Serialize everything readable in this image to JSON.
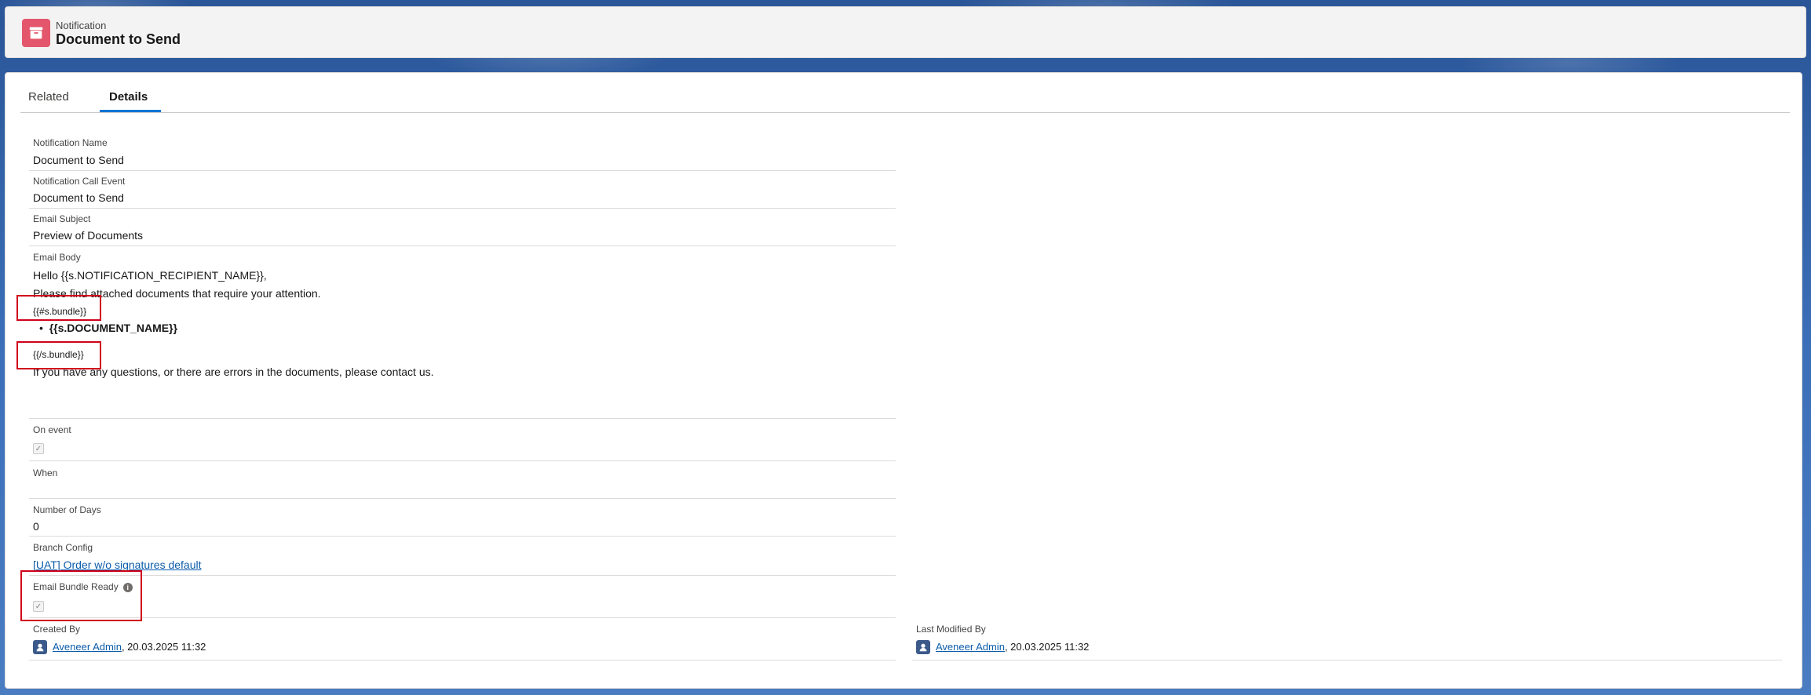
{
  "header": {
    "object_label": "Notification",
    "record_title": "Document to Send",
    "icon": "notification-icon"
  },
  "tabs": [
    {
      "label": "Related",
      "active": false
    },
    {
      "label": "Details",
      "active": true
    }
  ],
  "fields": {
    "notification_name": {
      "label": "Notification Name",
      "value": "Document to Send"
    },
    "call_event": {
      "label": "Notification Call Event",
      "value": "Document to Send"
    },
    "email_subject": {
      "label": "Email Subject",
      "value": "Preview of Documents"
    },
    "email_body": {
      "label": "Email Body",
      "lines": [
        "Hello {{s.NOTIFICATION_RECIPIENT_NAME}},",
        "Please find attached documents that require your attention.",
        "{{#s.bundle}}",
        "{{s.DOCUMENT_NAME}}",
        "{{/s.bundle}}",
        "If you have any questions, or there are errors in the documents, please contact us."
      ]
    },
    "on_event": {
      "label": "On event",
      "checked": true
    },
    "when": {
      "label": "When",
      "value": ""
    },
    "number_of_days": {
      "label": "Number of Days",
      "value": "0"
    },
    "branch_config": {
      "label": "Branch Config",
      "value": "[UAT] Order w/o signatures default"
    },
    "email_bundle_ready": {
      "label": "Email Bundle Ready",
      "checked": true,
      "info_icon": "info-icon"
    },
    "created_by": {
      "label": "Created By",
      "user": "Aveneer Admin",
      "date": ", 20.03.2025 11:32"
    },
    "last_modified_by": {
      "label": "Last Modified By",
      "user": "Aveneer Admin",
      "date": ", 20.03.2025 11:32"
    }
  },
  "colors": {
    "highlight_box": "#d0021b",
    "link": "#0b5cab",
    "record_icon": "#e3566b",
    "active_tab": "#0176d3"
  }
}
